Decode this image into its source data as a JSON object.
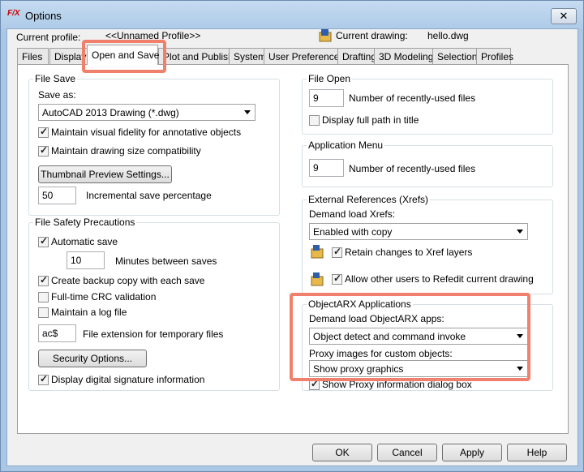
{
  "window": {
    "title": "Options",
    "app_icon": "F/X",
    "close": "✕"
  },
  "profile": {
    "label": "Current profile:",
    "value": "<<Unnamed Profile>>"
  },
  "drawing": {
    "label": "Current drawing:",
    "value": "hello.dwg"
  },
  "tabs": [
    "Files",
    "Display",
    "Open and Save",
    "Plot and Publish",
    "System",
    "User Preferences",
    "Drafting",
    "3D Modeling",
    "Selection",
    "Profiles"
  ],
  "file_save": {
    "title": "File Save",
    "save_as_label": "Save as:",
    "save_as_value": "AutoCAD 2013 Drawing (*.dwg)",
    "visual_fidelity": "Maintain visual fidelity for annotative objects",
    "size_compat": "Maintain drawing size compatibility",
    "thumbnail_button": "Thumbnail Preview Settings...",
    "incremental_value": "50",
    "incremental_label": "Incremental save percentage"
  },
  "safety": {
    "title": "File Safety Precautions",
    "auto_save": "Automatic save",
    "minutes_value": "10",
    "minutes_label": "Minutes between saves",
    "backup": "Create backup copy with each save",
    "crc": "Full-time CRC validation",
    "log": "Maintain a log file",
    "ext_value": "ac$",
    "ext_label": "File extension for temporary files",
    "security_button": "Security Options...",
    "signature": "Display digital signature information"
  },
  "file_open": {
    "title": "File Open",
    "recent_value": "9",
    "recent_label": "Number of recently-used files",
    "full_path": "Display full path in title"
  },
  "app_menu": {
    "title": "Application Menu",
    "recent_value": "9",
    "recent_label": "Number of recently-used files"
  },
  "xrefs": {
    "title": "External References (Xrefs)",
    "demand_label": "Demand load Xrefs:",
    "demand_value": "Enabled with copy",
    "retain": "Retain changes to Xref layers",
    "refedit": "Allow other users to Refedit current drawing"
  },
  "objectarx": {
    "title": "ObjectARX Applications",
    "demand_label": "Demand load ObjectARX apps:",
    "demand_value": "Object detect and command invoke",
    "proxy_label": "Proxy images for custom objects:",
    "proxy_value": "Show proxy graphics",
    "proxy_dialog": "Show Proxy information dialog box"
  },
  "buttons": {
    "ok": "OK",
    "cancel": "Cancel",
    "apply": "Apply",
    "help": "Help"
  }
}
